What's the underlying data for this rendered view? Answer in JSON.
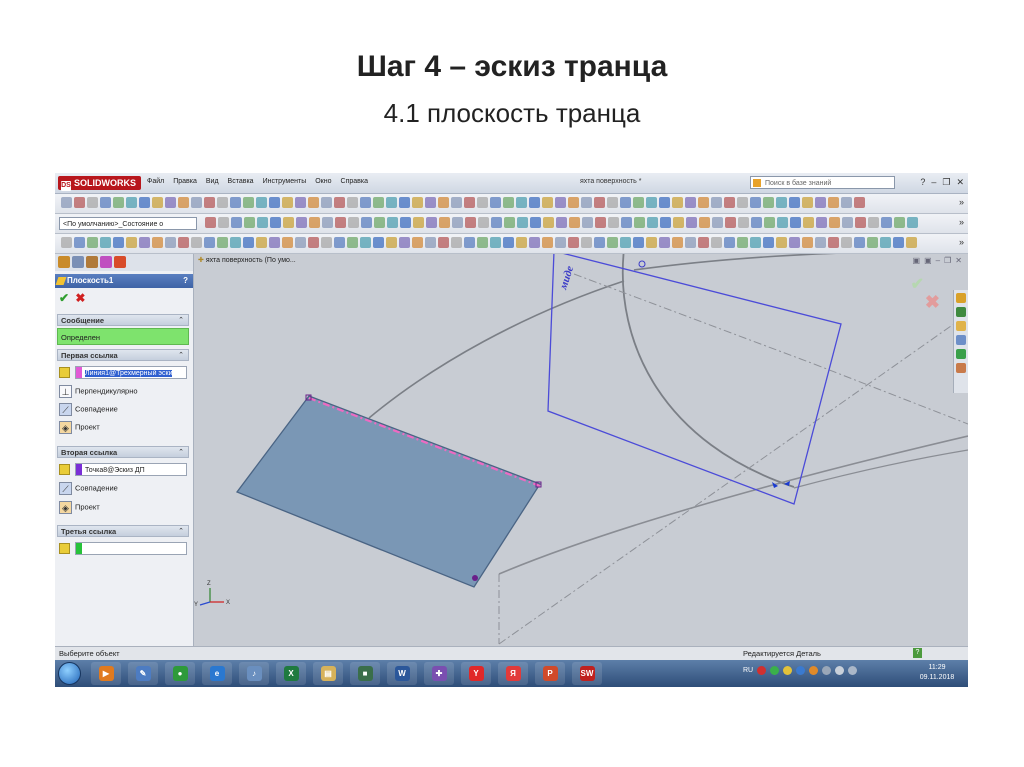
{
  "slide": {
    "title": "Шаг 4 – эскиз транца",
    "subtitle": "4.1 плоскость транца"
  },
  "app": {
    "logo": "SOLIDWORKS",
    "menu": [
      "Файл",
      "Правка",
      "Вид",
      "Вставка",
      "Инструменты",
      "Окно",
      "Справка"
    ],
    "document_title": "яхта поверхность *",
    "search_placeholder": "Поиск в базе знаний",
    "config_select": "<По умолчанию>_Состояние о"
  },
  "property_manager": {
    "title": "Плоскость1",
    "help": "?",
    "ok": "✔",
    "cancel": "✖",
    "message_section": "Сообщение",
    "message": "Определен",
    "first_ref": {
      "header": "Первая ссылка",
      "field": "Линия1@Трехмерный эски",
      "options": [
        "Перпендикулярно",
        "Совпадение",
        "Проект"
      ]
    },
    "second_ref": {
      "header": "Вторая ссылка",
      "field": "Точка8@Эскиз ДП",
      "options": [
        "Совпадение",
        "Проект"
      ]
    },
    "third_ref": {
      "header": "Третья ссылка",
      "field": ""
    }
  },
  "viewport": {
    "tree_crumb": "яхта поверхность  (По умо...",
    "plane_label": "миде"
  },
  "status": {
    "left": "Выберите объект",
    "right": "Редактируется Деталь",
    "help": "?"
  },
  "taskbar": {
    "language": "RU",
    "time": "11:29",
    "date": "09.11.2018",
    "apps": [
      {
        "name": "media-player",
        "color": "#e07a1f",
        "glyph": "▶"
      },
      {
        "name": "paint",
        "color": "#4d7cc2",
        "glyph": "✎"
      },
      {
        "name": "green-orb",
        "color": "#2e9a3a",
        "glyph": "●"
      },
      {
        "name": "internet-explorer",
        "color": "#2a78d0",
        "glyph": "e"
      },
      {
        "name": "speaker",
        "color": "#6a8fbf",
        "glyph": "♪"
      },
      {
        "name": "excel",
        "color": "#1f7a3f",
        "glyph": "X"
      },
      {
        "name": "explorer",
        "color": "#d7b25a",
        "glyph": "▤"
      },
      {
        "name": "monitor",
        "color": "#3a6e4a",
        "glyph": "■"
      },
      {
        "name": "word",
        "color": "#2b579a",
        "glyph": "W"
      },
      {
        "name": "tool",
        "color": "#7a4fb0",
        "glyph": "✚"
      },
      {
        "name": "yandex-browser",
        "color": "#e02828",
        "glyph": "Y"
      },
      {
        "name": "yandex",
        "color": "#e23a3a",
        "glyph": "Я"
      },
      {
        "name": "powerpoint",
        "color": "#d04a2a",
        "glyph": "P"
      },
      {
        "name": "solidworks",
        "color": "#c0211f",
        "glyph": "SW"
      }
    ]
  }
}
